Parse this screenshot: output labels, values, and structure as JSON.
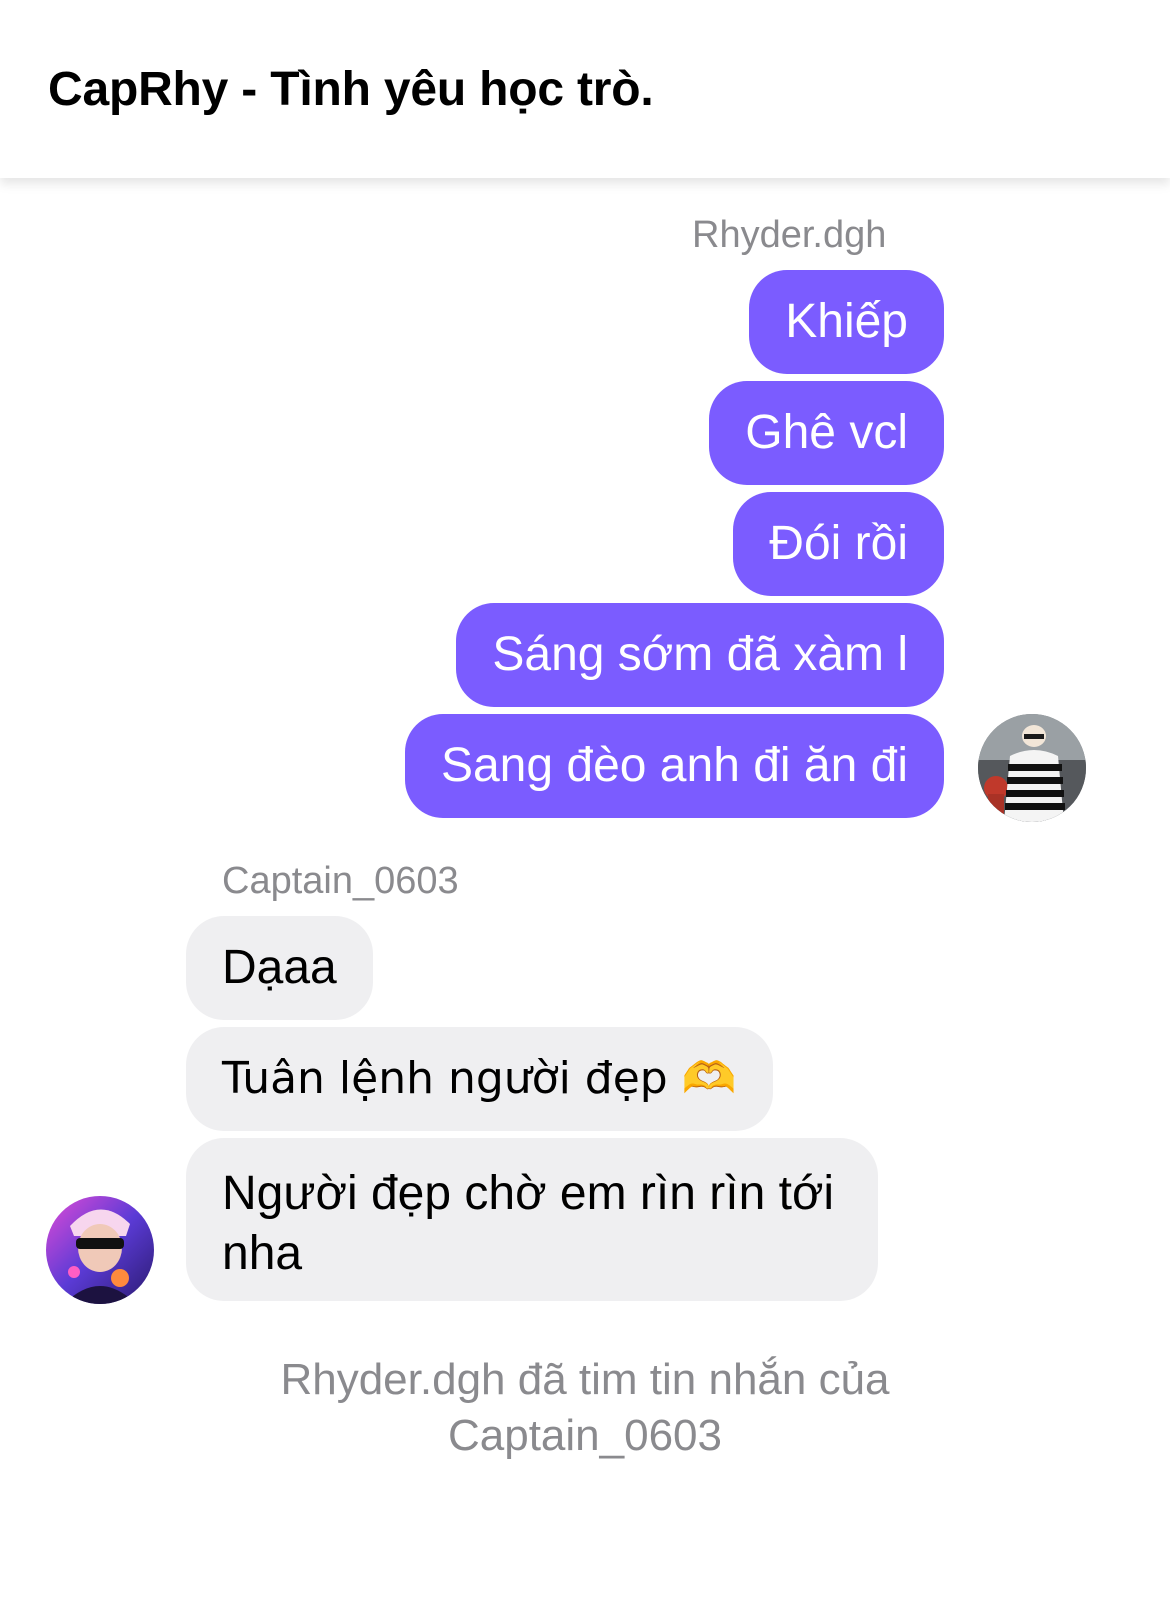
{
  "chat": {
    "title": "CapRhy - Tình yêu học trò."
  },
  "outgoing": {
    "sender": "Rhyder.dgh",
    "avatar_icon": "user-avatar-rhyder",
    "messages": [
      "Khiếp",
      "Ghê vcl",
      "Đói rồi",
      "Sáng sớm đã xàm l",
      "Sang đèo anh đi ăn đi"
    ]
  },
  "incoming": {
    "sender": "Captain_0603",
    "avatar_icon": "user-avatar-captain",
    "messages": [
      "Dạaa",
      "Tuân lệnh người đẹp 🫶",
      "Người đẹp chờ em rìn rìn tới nha"
    ]
  },
  "system": {
    "reaction_note": "Rhyder.dgh đã tim tin nhắn của Captain_0603"
  },
  "colors": {
    "outgoing_bubble": "#7b5cff",
    "incoming_bubble": "#efeff1",
    "meta_text": "#8a8a8e"
  }
}
